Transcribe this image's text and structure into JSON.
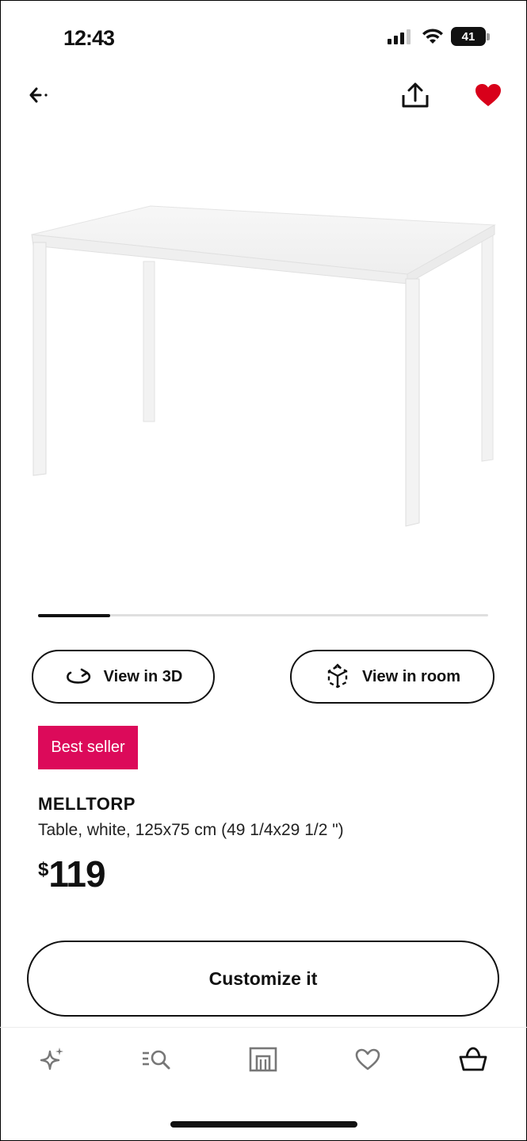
{
  "status_bar": {
    "time": "12:43",
    "battery": "41"
  },
  "nav": {
    "back_icon": "back-arrow-icon",
    "share_icon": "share-icon",
    "favorite_icon": "heart-icon"
  },
  "carousel": {
    "progress": 0.16
  },
  "actions": {
    "view_3d_label": "View in 3D",
    "view_room_label": "View in room"
  },
  "product": {
    "badge": "Best seller",
    "name": "MELLTORP",
    "description": "Table, white, 125x75 cm (49 1/4x29 1/2 \")",
    "currency": "$",
    "price": "119",
    "customize_label": "Customize it"
  },
  "tabbar": {
    "items": [
      "sparkle-icon",
      "search-list-icon",
      "store-icon",
      "heart-outline-icon",
      "basket-icon"
    ]
  },
  "colors": {
    "badge_bg": "#dc0a5a",
    "favorite": "#d8001a",
    "text": "#111111"
  }
}
